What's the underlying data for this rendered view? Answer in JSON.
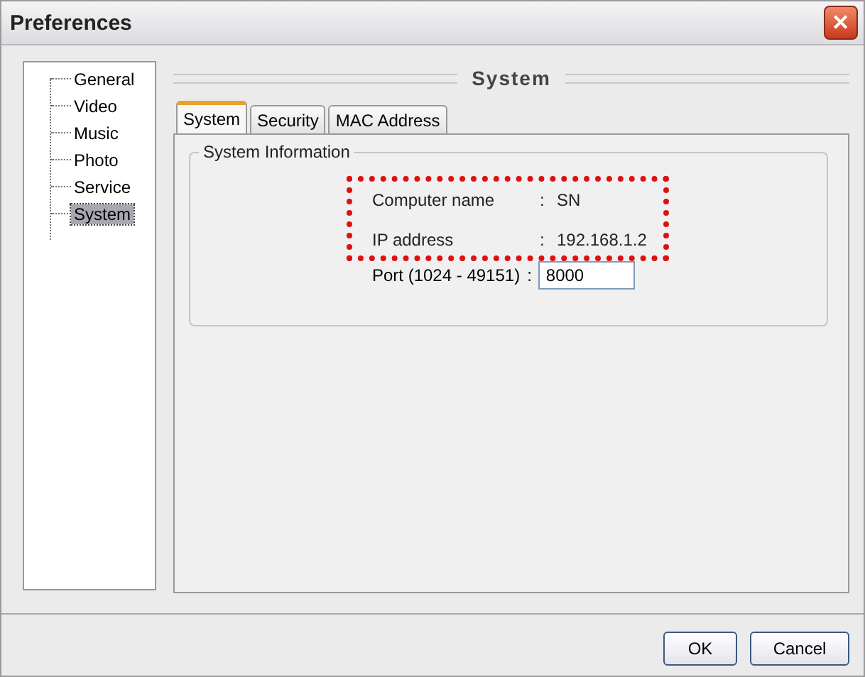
{
  "window": {
    "title": "Preferences",
    "close": "✕"
  },
  "tree": [
    {
      "label": "General",
      "selected": false
    },
    {
      "label": "Video",
      "selected": false
    },
    {
      "label": "Music",
      "selected": false
    },
    {
      "label": "Photo",
      "selected": false
    },
    {
      "label": "Service",
      "selected": false
    },
    {
      "label": "System",
      "selected": true
    }
  ],
  "section_title": "System",
  "tabs": [
    {
      "label": "System",
      "selected": true
    },
    {
      "label": "Security",
      "selected": false
    },
    {
      "label": "MAC Address",
      "selected": false
    }
  ],
  "group": {
    "title": "System Information",
    "highlighted": true,
    "rows": [
      {
        "label": "Computer name",
        "separator": ":",
        "value": "SN"
      },
      {
        "label": "IP address",
        "separator": ":",
        "value": "192.168.1.2"
      }
    ],
    "port": {
      "label": "Port (1024 - 49151)",
      "separator": ":",
      "value": "8000"
    }
  },
  "buttons": [
    "OK",
    "Cancel"
  ]
}
